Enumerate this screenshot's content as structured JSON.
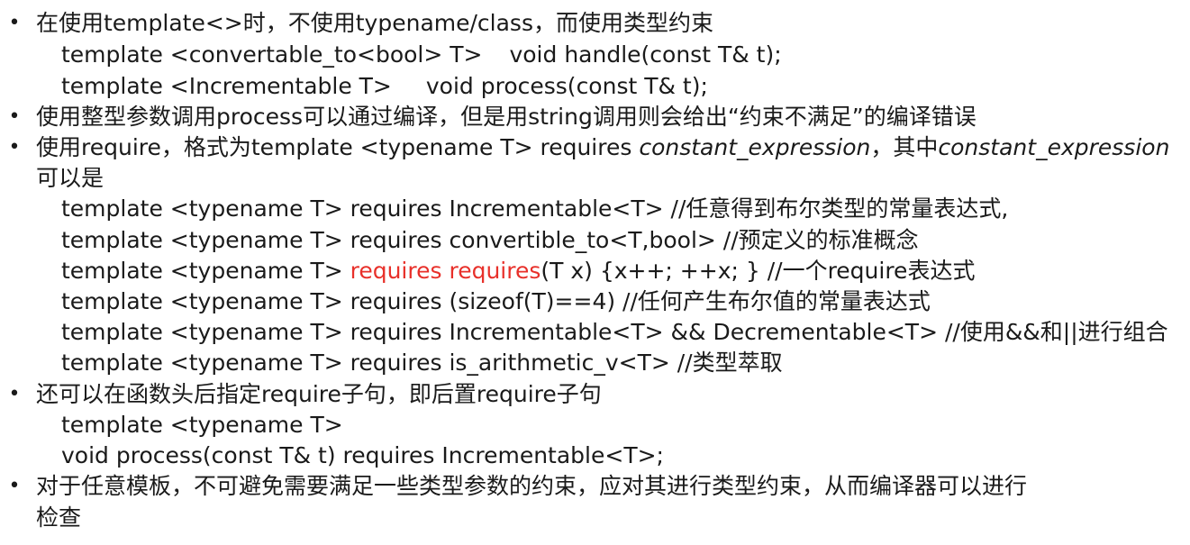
{
  "bullet_char": "•",
  "items": {
    "b1": {
      "text": "在使用template<>时，不使用typename/class，而使用类型约束",
      "code1a": "template <convertable_to<bool> T>",
      "code1b": "void handle(const T& t);",
      "code2a": "template <Incrementable T>",
      "code2b": "void process(const T& t);"
    },
    "b2": {
      "text": "使用整型参数调用process可以通过编译，但是用string调用则会给出“约束不满足”的编译错误"
    },
    "b3": {
      "t1": "使用require，格式为template <typename T> requires ",
      "t2": "constant_expression",
      "t3": "，其中",
      "t4": "constant_expression",
      "t5": "可以是",
      "ex1": "template <typename T> requires Incrementable<T> //任意得到布尔类型的常量表达式,",
      "ex2": "template <typename T> requires convertible_to<T,bool> //预定义的标准概念",
      "ex3a": "template <typename T> ",
      "ex3b": "requires requires",
      "ex3c": "(T x) {x++; ++x; }  //一个require表达式",
      "ex4": "template <typename T> requires (sizeof(T)==4)  //任何产生布尔值的常量表达式",
      "ex5": "template <typename T> requires Incrementable<T> && Decrementable<T>  //使用&&和||进行组合",
      "ex6": "template <typename T> requires is_arithmetic_v<T>  //类型萃取"
    },
    "b4": {
      "text": "还可以在函数头后指定require子句，即后置require子句",
      "code1": "template <typename T>",
      "code2": "void process(const T& t) requires Incrementable<T>;"
    },
    "b5": {
      "line1": "对于任意模板，不可避免需要满足一些类型参数的约束，应对其进行类型约束，从而编译器可以进行",
      "line2": "检查"
    }
  }
}
